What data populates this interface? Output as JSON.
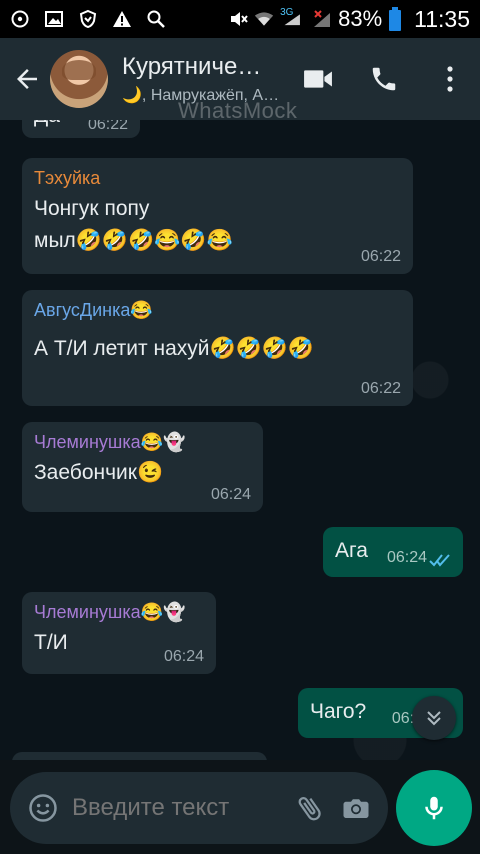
{
  "status_bar": {
    "icons_left": [
      "whatsapp-notif-icon",
      "image-icon",
      "shield-icon",
      "warning-icon",
      "search-icon"
    ],
    "network": "3G",
    "battery": "83%",
    "time": "11:35"
  },
  "header": {
    "title": "Курятниче…",
    "subtitle": "🌙, Намрукажёп, А…",
    "watermark": "WhatsMock"
  },
  "messages": [
    {
      "direction": "in",
      "sender": "",
      "text": "Да",
      "time": "06:22"
    },
    {
      "direction": "in",
      "sender": "Тэхуйка",
      "sender_color": "#e88a3a",
      "text": "Чонгук попу\nмыл🤣🤣🤣😂🤣😂",
      "time": "06:22"
    },
    {
      "direction": "in",
      "sender": "АвгусДинка😂",
      "sender_color": "#6aa7e8",
      "text": "А Т/И летит нахуй🤣🤣🤣🤣",
      "time": "06:22"
    },
    {
      "direction": "in",
      "sender": "Члеминушка😂👻",
      "sender_color": "#a77bd4",
      "text": "Заебончик😉",
      "time": "06:24"
    },
    {
      "direction": "out",
      "sender": "",
      "text": "Ага",
      "time": "06:24"
    },
    {
      "direction": "in",
      "sender": "Члеминушка😂👻",
      "sender_color": "#a77bd4",
      "text": "Т/И",
      "time": "06:24"
    },
    {
      "direction": "out",
      "sender": "",
      "text": "Чаго?",
      "time": "06:2"
    }
  ],
  "input": {
    "placeholder": "Введите текст"
  },
  "colors": {
    "accent": "#00a884",
    "read_ticks": "#53bdeb"
  }
}
